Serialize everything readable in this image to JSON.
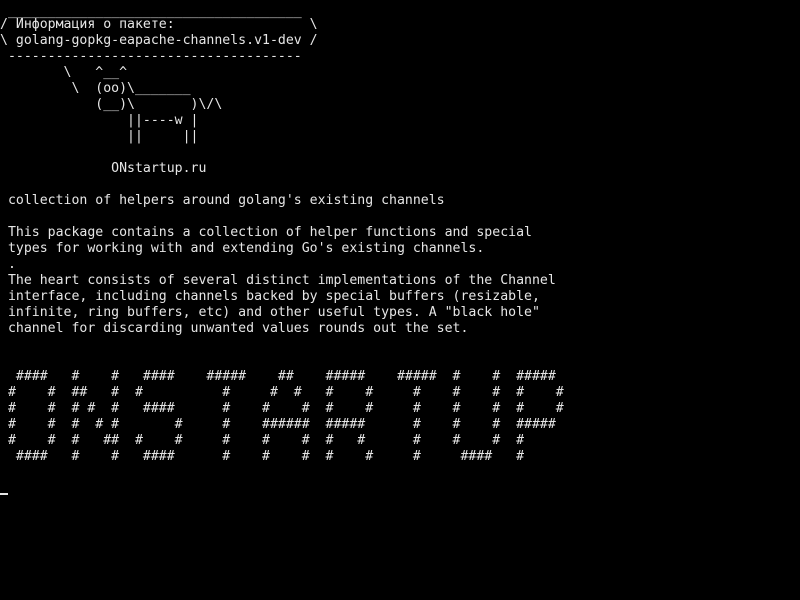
{
  "terminal": {
    "colors": {
      "background": "#000000",
      "foreground": "#e6e6e6"
    },
    "cowsay": {
      "border_top": " _____________________________________",
      "bubble_line_1": "/ Информация о пакете:                 \\",
      "bubble_line_2": "\\ golang-gopkg-eapache-channels.v1-dev /",
      "border_bottom": " -------------------------------------",
      "cow_line_1": "        \\   ^__^",
      "cow_line_2": "         \\  (oo)\\_______",
      "cow_line_3": "            (__)\\       )\\/\\",
      "cow_line_4": "                ||----w |",
      "cow_line_5": "                ||     ||",
      "site": "              ONstartup.ru"
    },
    "summary": " collection of helpers around golang's existing channels",
    "description": {
      "line_1": " This package contains a collection of helper functions and special",
      "line_2": " types for working with and extending Go's existing channels.",
      "line_3": " .",
      "line_4": " The heart consists of several distinct implementations of the Channel",
      "line_5": " interface, including channels backed by special buffers (resizable,",
      "line_6": " infinite, ring buffers, etc) and other useful types. A \"black hole\"",
      "line_7": " channel for discarding unwanted values rounds out the set."
    },
    "banner": {
      "line_1": "  ####   #    #   ####    #####    ##    #####    #####  #    #  #####",
      "line_2": " #    #  ##   #  #          #     #  #   #    #     #    #    #  #    #",
      "line_3": " #    #  # #  #   ####      #    #    #  #    #     #    #    #  #    #",
      "line_4": " #    #  #  # #       #     #    ######  #####      #    #    #  #####",
      "line_5": " #    #  #   ##  #    #     #    #    #  #   #      #    #    #  #",
      "line_6": "  ####   #    #   ####      #    #    #  #    #     #     ####   #"
    }
  }
}
